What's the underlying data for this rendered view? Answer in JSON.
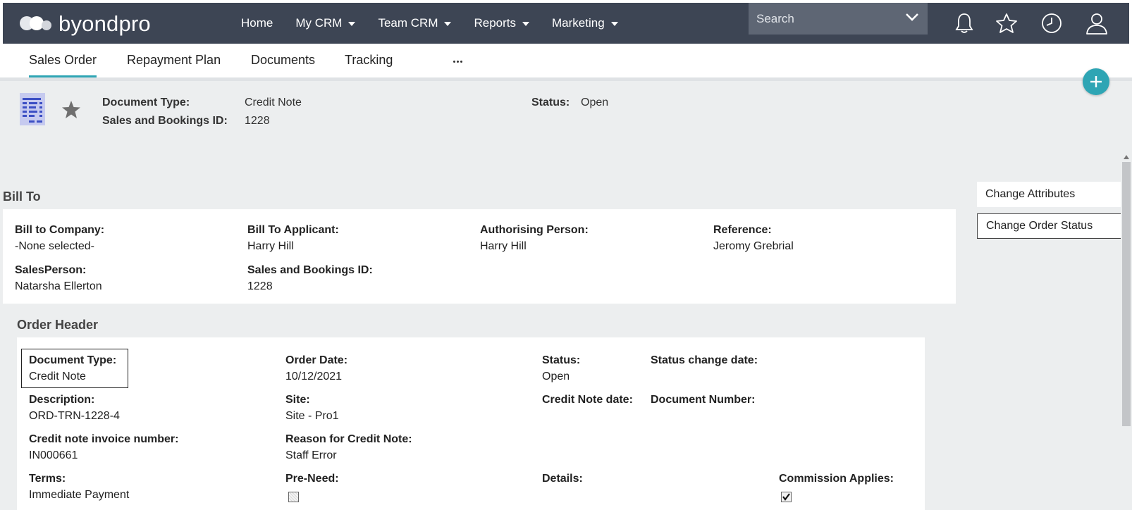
{
  "app": {
    "logo_text": "byondpro"
  },
  "nav": {
    "items": [
      {
        "label": "Home",
        "has_dropdown": false
      },
      {
        "label": "My CRM",
        "has_dropdown": true
      },
      {
        "label": "Team CRM",
        "has_dropdown": true
      },
      {
        "label": "Reports",
        "has_dropdown": true
      },
      {
        "label": "Marketing",
        "has_dropdown": true
      }
    ],
    "search_placeholder": "Search",
    "icons": [
      "bell-icon",
      "star-icon",
      "clock-icon",
      "user-icon"
    ]
  },
  "tabs": [
    {
      "label": "Sales Order",
      "active": true
    },
    {
      "label": "Repayment Plan",
      "active": false
    },
    {
      "label": "Documents",
      "active": false
    },
    {
      "label": "Tracking",
      "active": false
    }
  ],
  "doc_header": {
    "document_type_label": "Document Type:",
    "document_type_value": "Credit Note",
    "sales_bookings_label": "Sales and Bookings ID:",
    "sales_bookings_value": "1228",
    "status_label": "Status:",
    "status_value": "Open"
  },
  "actions": [
    "Change Attributes",
    "Change Order Status"
  ],
  "bill_to": {
    "title": "Bill To",
    "fields": {
      "company": {
        "label": "Bill to Company:",
        "value": "-None selected-"
      },
      "applicant": {
        "label": "Bill To Applicant:",
        "value": "Harry Hill"
      },
      "authorising": {
        "label": "Authorising Person:",
        "value": "Harry Hill"
      },
      "reference": {
        "label": "Reference:",
        "value": "Jeromy Grebrial"
      },
      "salesperson": {
        "label": "SalesPerson:",
        "value": "Natarsha Ellerton"
      },
      "sales_bookings": {
        "label": "Sales and Bookings ID:",
        "value": "1228"
      }
    }
  },
  "order_header": {
    "title": "Order Header",
    "fields": {
      "document_type": {
        "label": "Document Type:",
        "value": "Credit Note"
      },
      "order_date": {
        "label": "Order Date:",
        "value": "10/12/2021"
      },
      "status": {
        "label": "Status:",
        "value": "Open"
      },
      "status_change_date": {
        "label": "Status change date:",
        "value": ""
      },
      "description": {
        "label": "Description:",
        "value": "ORD-TRN-1228-4"
      },
      "site": {
        "label": "Site:",
        "value": "Site - Pro1"
      },
      "credit_note_date": {
        "label": "Credit Note date:",
        "value": ""
      },
      "document_number": {
        "label": "Document Number:",
        "value": ""
      },
      "credit_note_invoice": {
        "label": "Credit note invoice number:",
        "value": "IN000661"
      },
      "reason": {
        "label": "Reason for Credit Note:",
        "value": "Staff Error"
      },
      "terms": {
        "label": "Terms:",
        "value": "Immediate Payment"
      },
      "pre_need": {
        "label": "Pre-Need:",
        "checked": false
      },
      "details": {
        "label": "Details:",
        "value": ""
      },
      "commission": {
        "label": "Commission Applies:",
        "checked": true
      }
    }
  },
  "colors": {
    "topbar": "#3d4554",
    "accent": "#2ea5b4",
    "link": "#2a98a8",
    "content_bg": "#eceeef"
  }
}
